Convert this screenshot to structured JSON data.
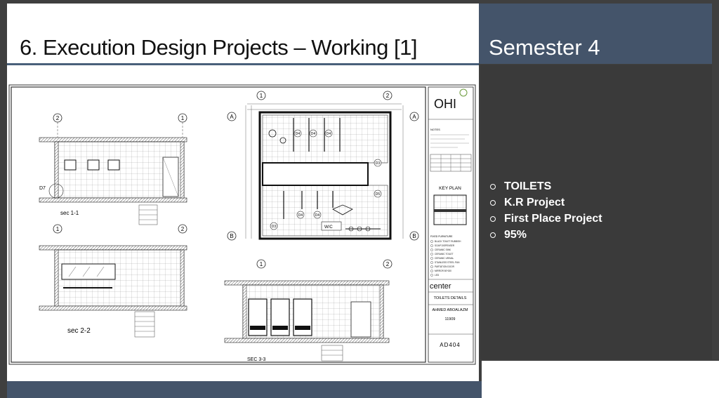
{
  "slide": {
    "title": "6.   Execution Design Projects – Working [1]",
    "semester": "Semester 4",
    "bullets": [
      "TOILETS",
      "K.R Project",
      "First Place Project",
      "95%"
    ]
  },
  "drawing": {
    "sections": {
      "sec11": "sec 1-1",
      "sec22": "sec 2-2",
      "sec33": "SEC 3-3",
      "d7": "D7"
    },
    "grid": {
      "one": "1",
      "two": "2",
      "a": "A",
      "b": "B"
    },
    "doors": {
      "d4": "D4",
      "d3": "D3",
      "d5": "D5"
    },
    "wc_label": "W/C",
    "title_block": {
      "logo": "OHI",
      "notes_label": "NOTES",
      "key_plan": "KEY PLAN",
      "legend_title": "FIXED FURNITURE",
      "legend": [
        "BLACK TOILET RUBBISH",
        "SOAP DISPENSER",
        "CERAMIC SINK",
        "CERAMIC TOILET",
        "CERAMIC URINAL",
        "STAINLESS STEEL PAN",
        "PARTATION DOOR",
        "MIRROR 80*150",
        "LED"
      ],
      "center": "center",
      "sheet_title": "TOILETS DETAILS",
      "author": "AHMED ABOALAZM",
      "id": "11909",
      "sheet_no": "AD404"
    }
  },
  "colors": {
    "header_blue": "#44546a",
    "dark_panel": "#3a3a3a",
    "rule_blue": "#49607a"
  }
}
